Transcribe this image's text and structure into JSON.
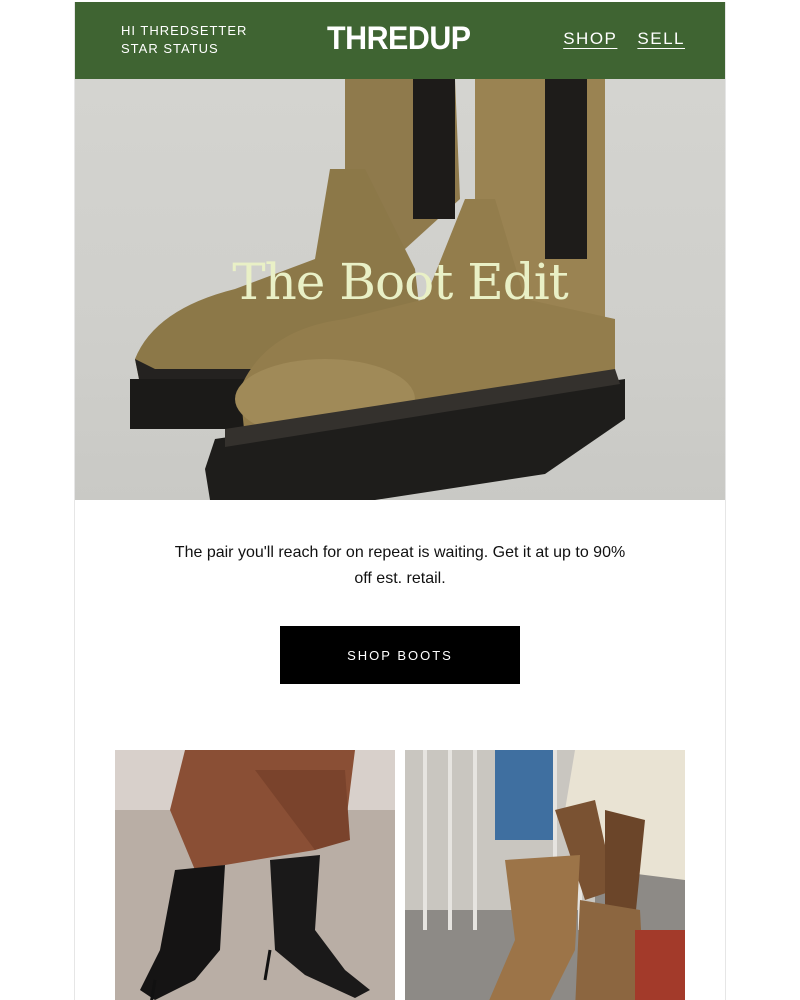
{
  "header": {
    "greeting_line1": "HI THREDSETTER",
    "greeting_line2": "STAR STATUS",
    "logo": "THREDUP",
    "nav": [
      "SHOP",
      "SELL"
    ],
    "bg_color": "#3f6432"
  },
  "hero": {
    "title": "The Boot Edit",
    "title_color": "#e9f0c6",
    "image": "olive-leather-lug-sole-chelsea-boots"
  },
  "body": {
    "copy": "The pair you'll reach for on repeat is waiting. Get it at up to 90% off est. retail.",
    "cta_label": "SHOP BOOTS"
  },
  "products": [
    {
      "image": "black-patent-stiletto-ankle-boots"
    },
    {
      "image": "tan-suede-knee-high-boots"
    }
  ]
}
